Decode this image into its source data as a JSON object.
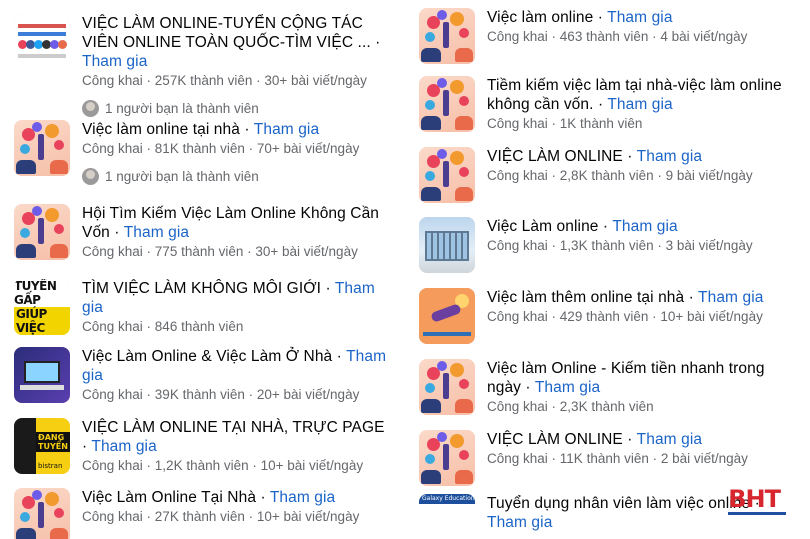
{
  "join_label": "Tham gia",
  "left_groups": [
    {
      "name": "VIỆC LÀM ONLINE-TUYỂN CỘNG TÁC VIÊN ONLINE TOÀN QUỐC-TÌM VIỆC ...",
      "privacy": "Công khai",
      "members": "257K thành viên",
      "posts": "30+ bài viết/ngày",
      "friends": "1 người bạn là thành viên",
      "thumb": "list-grid"
    },
    {
      "name": "Việc làm online tại nhà",
      "privacy": "Công khai",
      "members": "81K thành viên",
      "posts": "70+ bài viết/ngày",
      "friends": "1 người bạn là thành viên",
      "thumb": "hands-hearts"
    },
    {
      "name": "Hội Tìm Kiếm Việc Làm Online Không Cần Vốn",
      "privacy": "Công khai",
      "members": "775 thành viên",
      "posts": "30+ bài viết/ngày",
      "thumb": "hands-hearts"
    },
    {
      "name": "TÌM VIỆC LÀM KHÔNG MÔI GIỚI",
      "privacy": "Công khai",
      "members": "846 thành viên",
      "thumb": "text-poster"
    },
    {
      "name": "Việc Làm Online & Việc Làm Ở Nhà",
      "privacy": "Công khai",
      "members": "39K thành viên",
      "posts": "20+ bài viết/ngày",
      "thumb": "laptop"
    },
    {
      "name": "VIỆC LÀM ONLINE TẠI NHÀ, TRỰC PAGE",
      "privacy": "Công khai",
      "members": "1,2K thành viên",
      "posts": "10+ bài viết/ngày",
      "thumb": "page-poster"
    },
    {
      "name": "Việc Làm Online Tại Nhà",
      "privacy": "Công khai",
      "members": "27K thành viên",
      "posts": "10+ bài viết/ngày",
      "thumb": "hands-hearts"
    }
  ],
  "right_groups": [
    {
      "name": "Việc làm online",
      "privacy": "Công khai",
      "members": "463 thành viên",
      "posts": "4 bài viết/ngày",
      "thumb": "hands-hearts"
    },
    {
      "name": "Tiềm kiếm việc làm tại nhà-việc làm online không cần vốn.",
      "privacy": "Công khai",
      "members": "1K thành viên",
      "thumb": "hands-hearts"
    },
    {
      "name": "VIỆC LÀM ONLINE",
      "privacy": "Công khai",
      "members": "2,8K thành viên",
      "posts": "9 bài viết/ngày",
      "thumb": "hands-hearts"
    },
    {
      "name": "Việc Làm online",
      "privacy": "Công khai",
      "members": "1,3K thành viên",
      "posts": "3 bài viết/ngày",
      "thumb": "building"
    },
    {
      "name": "Việc làm thêm online tại nhà",
      "privacy": "Công khai",
      "members": "429 thành viên",
      "posts": "10+ bài viết/ngày",
      "thumb": "yoga"
    },
    {
      "name": "Việc làm Online - Kiếm tiền nhanh trong ngày",
      "privacy": "Công khai",
      "members": "2,3K thành viên",
      "thumb": "hands-hearts"
    },
    {
      "name": "VIỆC LÀM ONLINE",
      "privacy": "Công khai",
      "members": "11K thành viên",
      "posts": "2 bài viết/ngày",
      "thumb": "hands-hearts"
    },
    {
      "name": "Tuyển dụng nhân viên làm việc online",
      "privacy": "",
      "members": "",
      "thumb": "galaxy"
    }
  ],
  "thumb_text": {
    "text_poster_line1": "TUYỂN GẤP",
    "text_poster_line2": "GIÚP VIỆC",
    "page_poster_tag": "ĐANG TUYỂN",
    "page_poster_foot": "bistran",
    "galaxy_title": "Galaxy Education"
  },
  "watermark": "BHT",
  "colors": {
    "join": "#1b64c8",
    "meta": "#65676b",
    "logo": "#d7262e"
  }
}
